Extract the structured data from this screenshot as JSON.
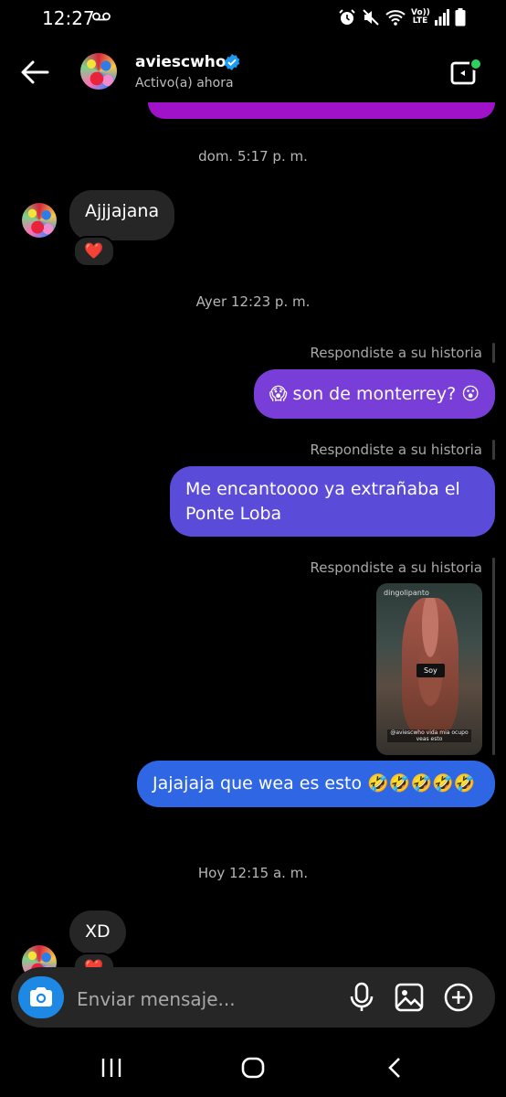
{
  "status_bar": {
    "time": "12:27",
    "network": "Vo)) LTE"
  },
  "header": {
    "username": "aviescwho",
    "subtitle": "Activo(a) ahora"
  },
  "timestamps": [
    "dom. 5:17 p. m.",
    "Ayer 12:23 p. m.",
    "Hoy 12:15 a. m."
  ],
  "messages": {
    "in_1": {
      "text": "Ajjjajana",
      "reaction": "❤️"
    },
    "out_1": {
      "label": "Respondiste a su historia",
      "text": "😱 son de monterrey? 😮"
    },
    "out_2": {
      "label": "Respondiste a su historia",
      "text": "Me encantoooo ya extrañaba el Ponte Loba"
    },
    "out_3": {
      "label": "Respondiste a su historia",
      "story_user": "dingolipanto",
      "story_overlay": "Soy",
      "story_caption": "@aviescwho vida mia ocupo veas esto",
      "text": "Jajajaja que wea es esto 🤣🤣🤣🤣🤣"
    },
    "in_2": {
      "text": "XD",
      "reaction": "❤️"
    }
  },
  "composer": {
    "placeholder": "Enviar mensaje..."
  },
  "colors": {
    "bubble_out_1": "#7a3ed8",
    "bubble_out_2": "#5b4bd9",
    "bubble_out_3": "#2e66e3",
    "incoming_bubble": "#262626",
    "accent_blue": "#1e88e5"
  }
}
